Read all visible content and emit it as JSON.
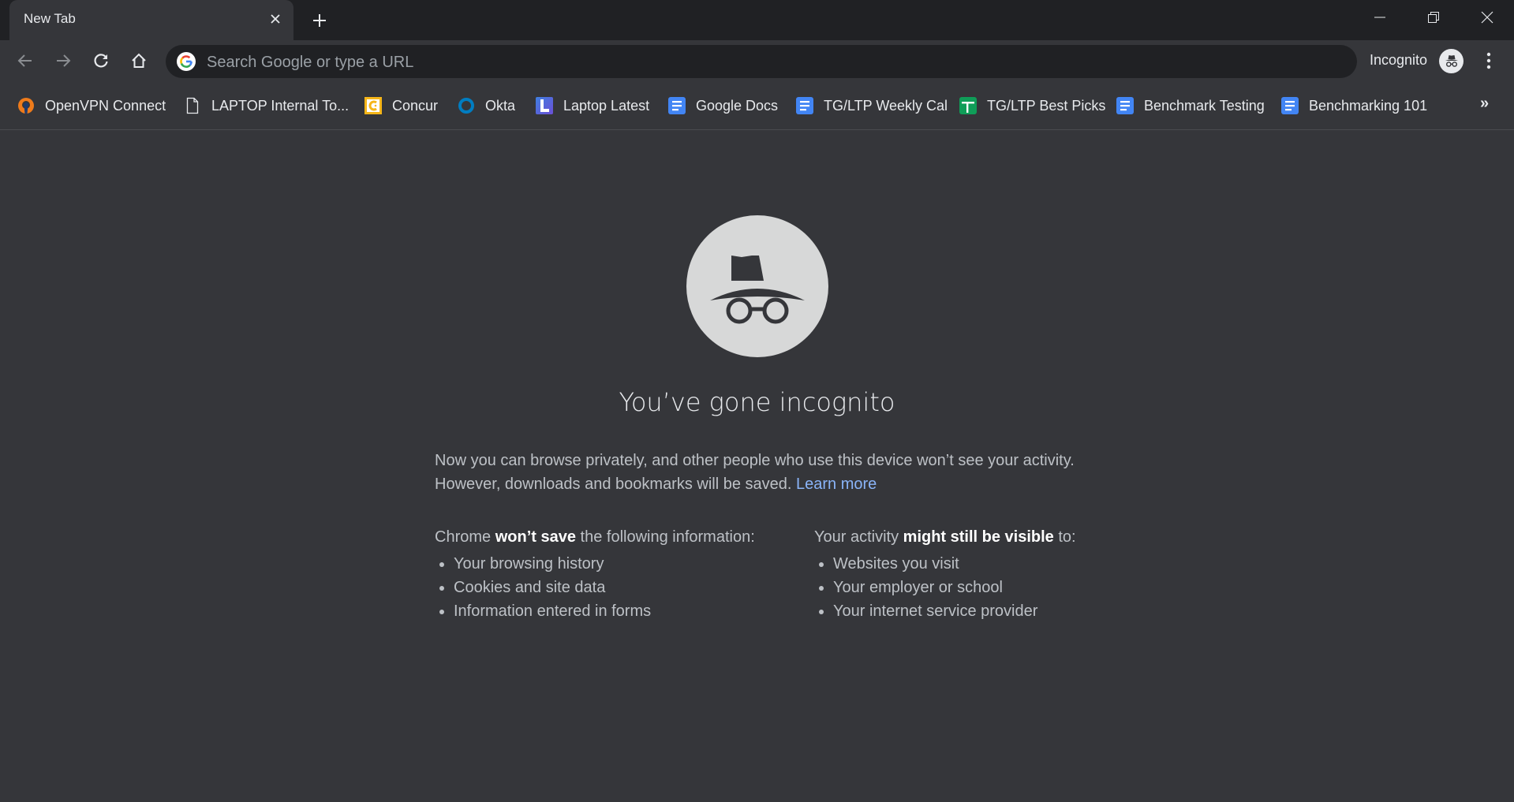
{
  "window": {
    "tabs": [
      {
        "title": "New Tab",
        "active": true
      }
    ],
    "controls": {
      "minimize": "minimize",
      "restore": "restore",
      "close": "close"
    }
  },
  "toolbar": {
    "omnibox_placeholder": "Search Google or type a URL",
    "omnibox_value": "",
    "profile_label": "Incognito"
  },
  "bookmarks": [
    {
      "label": "OpenVPN Connect",
      "icon": "openvpn-icon"
    },
    {
      "label": "LAPTOP Internal To...",
      "icon": "page-icon"
    },
    {
      "label": "Concur",
      "icon": "concur-icon"
    },
    {
      "label": "Okta",
      "icon": "okta-icon"
    },
    {
      "label": "Laptop Latest",
      "icon": "laptop-latest-icon"
    },
    {
      "label": "Google Docs",
      "icon": "google-docs-icon"
    },
    {
      "label": "TG/LTP Weekly Cal",
      "icon": "google-docs-icon"
    },
    {
      "label": "TG/LTP Best Picks",
      "icon": "google-sheets-icon"
    },
    {
      "label": "Benchmark Testing",
      "icon": "google-docs-icon"
    },
    {
      "label": "Benchmarking 101",
      "icon": "google-docs-icon"
    }
  ],
  "bookmarks_overflow": "»",
  "page": {
    "headline": "You’ve gone incognito",
    "intro": "Now you can browse privately, and other people who use this device won’t see your activity. However, downloads and bookmarks will be saved.",
    "learn_more": "Learn more",
    "left": {
      "lead_before": "Chrome ",
      "lead_bold": "won’t save",
      "lead_after": " the following information:",
      "items": [
        "Your browsing history",
        "Cookies and site data",
        "Information entered in forms"
      ]
    },
    "right": {
      "lead_before": "Your activity ",
      "lead_bold": "might still be visible",
      "lead_after": " to:",
      "items": [
        "Websites you visit",
        "Your employer or school",
        "Your internet service provider"
      ]
    }
  },
  "colors": {
    "background": "#35363a",
    "titlebar": "#202124",
    "link": "#8ab4f8",
    "docs_blue": "#4285f4",
    "sheets_green": "#0f9d58",
    "concur_orange": "#f6b619",
    "openvpn_orange": "#ee7b1b",
    "okta_blue": "#007dc1"
  }
}
